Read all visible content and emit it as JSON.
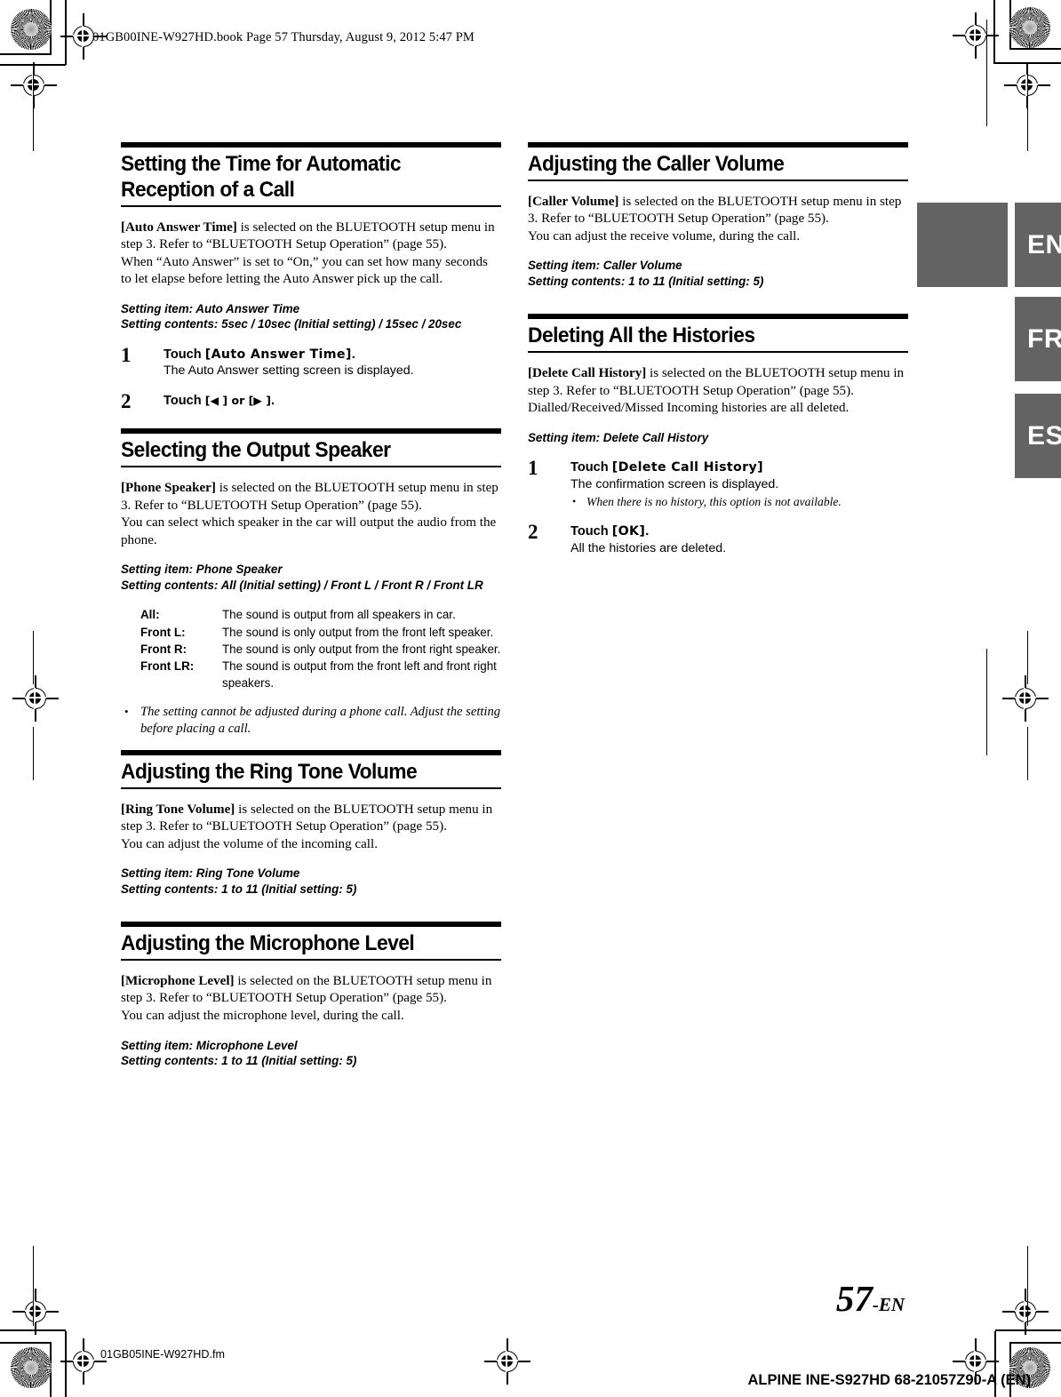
{
  "header": {
    "file_info": "01GB00INE-W927HD.book  Page 57  Thursday, August 9, 2012  5:47 PM"
  },
  "language_tabs": [
    {
      "label": "EN"
    },
    {
      "label": "FR"
    },
    {
      "label": "ES"
    }
  ],
  "colors": {
    "tab_background": "#636363",
    "tab_text": "#ffffff",
    "rule": "#000000",
    "page_background": "#ffffff"
  },
  "left_column": {
    "sections": [
      {
        "heading": "Setting the Time for Automatic Reception of a Call",
        "paragraph_lead": "[Auto Answer Time]",
        "paragraph_rest": " is selected on the BLUETOOTH setup menu in step 3. Refer to “BLUETOOTH Setup Operation” (page 55).",
        "paragraph_extra": "When “Auto Answer” is set to “On,” you can set how many seconds to let elapse before letting the Auto Answer pick up the call.",
        "setting_item": "Setting item: Auto Answer Time",
        "setting_contents": "Setting contents: 5sec / 10sec (Initial setting) / 15sec / 20sec",
        "steps": [
          {
            "number": "1",
            "verb": "Touch ",
            "key": "[Auto Answer Time]",
            "tail": ".",
            "desc": "The Auto Answer setting screen is displayed."
          },
          {
            "number": "2",
            "verb": "Touch ",
            "key": "[◀ ] or [▶ ]",
            "tail": ".",
            "desc": ""
          }
        ]
      },
      {
        "heading": "Selecting the Output Speaker",
        "paragraph_lead": "[Phone Speaker]",
        "paragraph_rest": " is selected on the BLUETOOTH setup menu in step 3. Refer to “BLUETOOTH Setup Operation” (page 55).",
        "paragraph_extra": "You can select which speaker in the car will output the audio from the phone.",
        "setting_item": "Setting item: Phone Speaker",
        "setting_contents": "Setting contents: All (Initial setting) / Front L / Front R / Front LR",
        "definitions": [
          {
            "term": "All:",
            "desc": "The sound is output from all speakers in car."
          },
          {
            "term": "Front L:",
            "desc": "The sound is only output from the front left speaker."
          },
          {
            "term": "Front R:",
            "desc": "The sound is only output from the front right speaker."
          },
          {
            "term": "Front LR:",
            "desc": "The sound is output from the front left and front right speakers."
          }
        ],
        "note": "The setting cannot be adjusted during a phone call. Adjust the setting before placing a call."
      },
      {
        "heading": "Adjusting the Ring Tone Volume",
        "paragraph_lead": "[Ring Tone Volume]",
        "paragraph_rest": " is selected on the BLUETOOTH setup menu in step 3. Refer to “BLUETOOTH Setup Operation” (page 55).",
        "paragraph_extra": "You can adjust the volume of the incoming call.",
        "setting_item": "Setting item: Ring Tone Volume",
        "setting_contents": "Setting contents: 1 to 11 (Initial setting: 5)"
      },
      {
        "heading": "Adjusting the Microphone Level",
        "paragraph_lead": "[Microphone Level]",
        "paragraph_rest": " is selected on the BLUETOOTH setup menu in step 3. Refer to “BLUETOOTH Setup Operation” (page 55).",
        "paragraph_extra": "You can adjust the microphone level, during the call.",
        "setting_item": "Setting item: Microphone Level",
        "setting_contents": "Setting contents: 1 to 11 (Initial setting: 5)"
      }
    ]
  },
  "right_column": {
    "sections": [
      {
        "heading": "Adjusting the Caller Volume",
        "paragraph_lead": "[Caller Volume]",
        "paragraph_rest": " is selected on the BLUETOOTH setup menu in step 3. Refer to “BLUETOOTH Setup Operation” (page 55).",
        "paragraph_extra": "You can adjust the receive volume, during the call.",
        "setting_item": "Setting item: Caller Volume",
        "setting_contents": "Setting contents: 1 to 11 (Initial setting: 5)"
      },
      {
        "heading": "Deleting All the Histories",
        "paragraph_lead": "[Delete Call History]",
        "paragraph_rest": " is selected on the BLUETOOTH setup menu in step 3. Refer to “BLUETOOTH Setup Operation” (page 55).",
        "paragraph_extra": "Dialled/Received/Missed Incoming histories are all deleted.",
        "setting_item": "Setting item: Delete Call History",
        "setting_contents": "",
        "steps": [
          {
            "number": "1",
            "verb": "Touch ",
            "key": "[Delete Call History]",
            "tail": "",
            "desc": "The confirmation screen is displayed.",
            "subnote": "When there is no history, this option is not available."
          },
          {
            "number": "2",
            "verb": "Touch ",
            "key": "[OK]",
            "tail": ".",
            "desc": "All the histories are deleted."
          }
        ]
      }
    ]
  },
  "footer": {
    "page_number": "57",
    "page_suffix": "-EN",
    "file_name": "01GB05INE-W927HD.fm",
    "model_line": "ALPINE INE-S927HD 68-21057Z90-A (EN)"
  }
}
